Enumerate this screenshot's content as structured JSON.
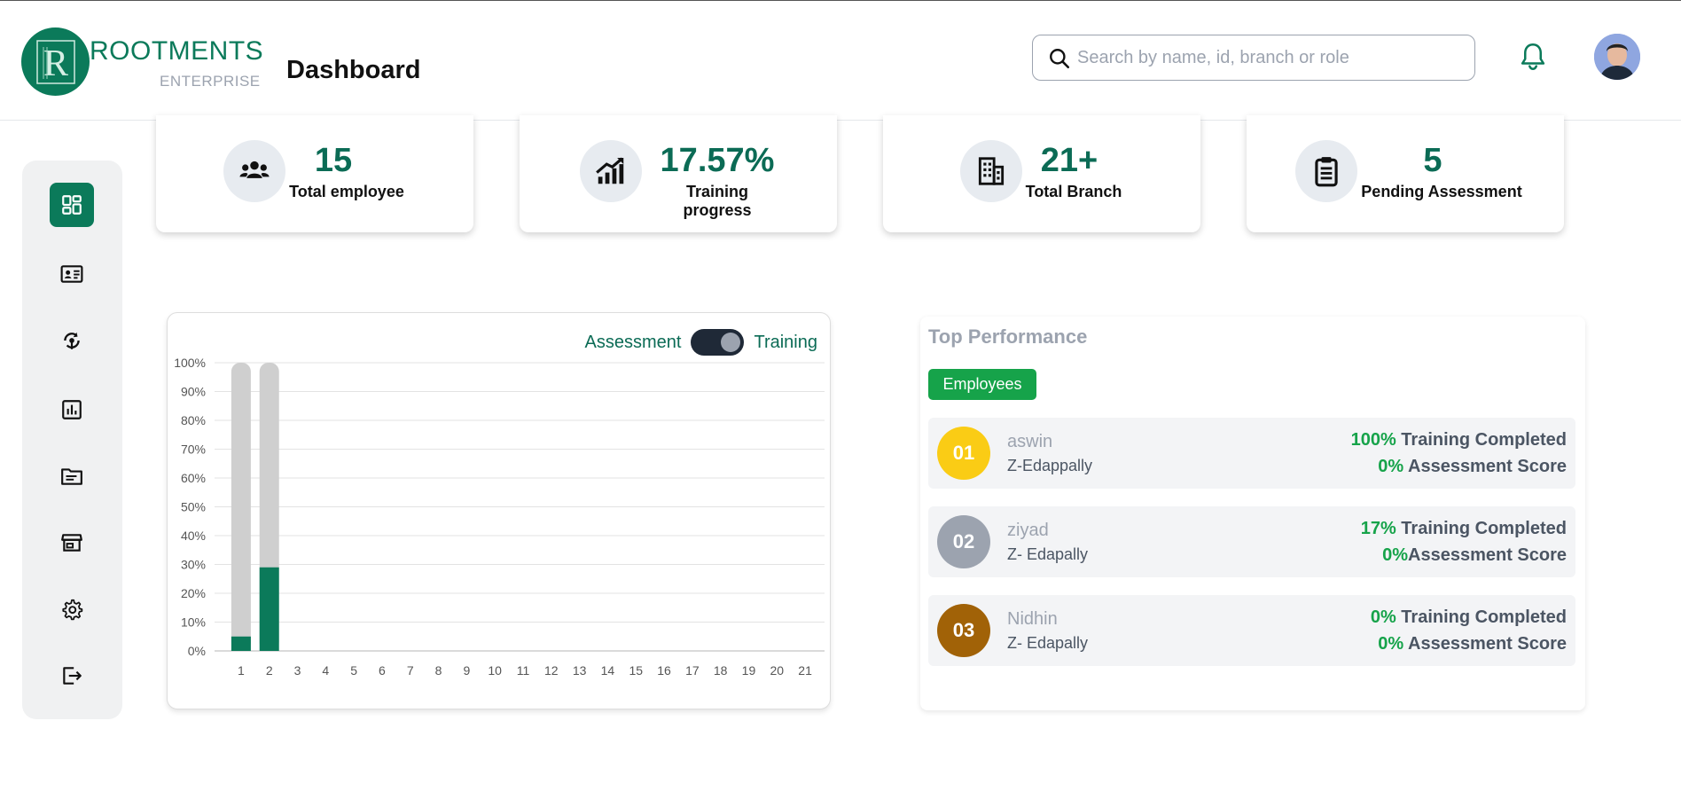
{
  "header": {
    "brand_name": "ROOTMENTS",
    "brand_sub": "ENTERPRISE",
    "logo_letter": "R",
    "page_title": "Dashboard",
    "search_placeholder": "Search by name, id, branch or role"
  },
  "sidebar": {
    "items": [
      {
        "icon": "dashboard-icon",
        "active": true
      },
      {
        "icon": "id-card-icon",
        "active": false
      },
      {
        "icon": "training-icon",
        "active": false
      },
      {
        "icon": "report-chart-icon",
        "active": false
      },
      {
        "icon": "folder-icon",
        "active": false
      },
      {
        "icon": "store-icon",
        "active": false
      },
      {
        "icon": "gear-icon",
        "active": false
      },
      {
        "icon": "logout-icon",
        "active": false
      }
    ]
  },
  "stats": [
    {
      "icon": "users-icon",
      "value": "15",
      "label": "Total employee"
    },
    {
      "icon": "growth-chart-icon",
      "value": "17.57%",
      "label": "Training progress"
    },
    {
      "icon": "building-icon",
      "value": "21+",
      "label": "Total Branch"
    },
    {
      "icon": "clipboard-icon",
      "value": "5",
      "label": "Pending Assessment"
    }
  ],
  "chart_toggle": {
    "left_label": "Assessment",
    "right_label": "Training",
    "selected": "Training"
  },
  "chart_data": {
    "type": "bar",
    "categories": [
      "1",
      "2",
      "3",
      "4",
      "5",
      "6",
      "7",
      "8",
      "9",
      "10",
      "11",
      "12",
      "13",
      "14",
      "15",
      "16",
      "17",
      "18",
      "19",
      "20",
      "21"
    ],
    "series": [
      {
        "values": [
          5,
          29,
          null,
          null,
          null,
          null,
          null,
          null,
          null,
          null,
          null,
          null,
          null,
          null,
          null,
          null,
          null,
          null,
          null,
          null,
          null
        ]
      }
    ],
    "background_bars": [
      100,
      100,
      null,
      null,
      null,
      null,
      null,
      null,
      null,
      null,
      null,
      null,
      null,
      null,
      null,
      null,
      null,
      null,
      null,
      null,
      null
    ],
    "y_ticks": [
      "0%",
      "10%",
      "20%",
      "30%",
      "40%",
      "50%",
      "60%",
      "70%",
      "80%",
      "90%",
      "100%"
    ],
    "ylim": [
      0,
      100
    ],
    "grid": true,
    "colors": {
      "bar": "#0b7a5a",
      "background": "#cfcfcf"
    }
  },
  "top_performance": {
    "title": "Top Performance",
    "tab": "Employees",
    "rows": [
      {
        "rank": "01",
        "rank_color": "#facc15",
        "name": "aswin",
        "branch": "Z-Edappally",
        "training_pct": "100%",
        "training_label": " Training Completed",
        "assessment_pct": "0%",
        "assessment_label": " Assessment Score"
      },
      {
        "rank": "02",
        "rank_color": "#9ca3af",
        "name": "ziyad",
        "branch": "Z- Edapally",
        "training_pct": "17%",
        "training_label": " Training Completed",
        "assessment_pct": "0%",
        "assessment_label": "Assessment Score"
      },
      {
        "rank": "03",
        "rank_color": "#a16207",
        "name": "Nidhin",
        "branch": "Z- Edapally",
        "training_pct": "0%",
        "training_label": " Training Completed",
        "assessment_pct": "0%",
        "assessment_label": " Assessment Score"
      }
    ]
  }
}
